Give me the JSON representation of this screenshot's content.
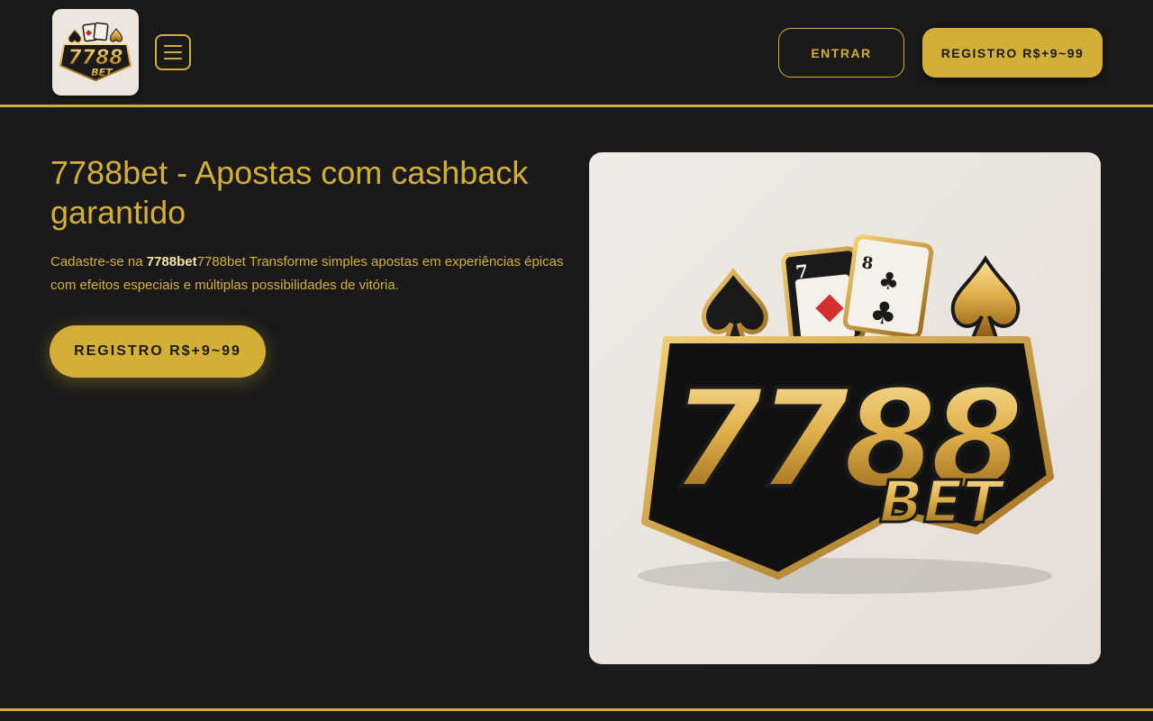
{
  "header": {
    "logo_text_top": "7788",
    "logo_text_bottom": "BET",
    "login_label": "ENTRAR",
    "register_label": "REGISTRO R$+9~99"
  },
  "hero": {
    "title": "7788bet - Apostas com cashback garantido",
    "text_prefix": "Cadastre-se na ",
    "text_bold": "7788bet",
    "text_suffix": "7788bet Transforme simples apostas em experiências épicas com efeitos especiais e múltiplas possibilidades de vitória.",
    "cta_label": "REGISTRO R$+9~99",
    "image_text_top": "7788",
    "image_text_bottom": "BET"
  },
  "colors": {
    "background": "#1a1a1a",
    "accent": "#d4af37",
    "logo_bg": "#ece6df"
  },
  "icons": [
    "menu-icon",
    "spade-icon",
    "playing-cards-icon"
  ]
}
